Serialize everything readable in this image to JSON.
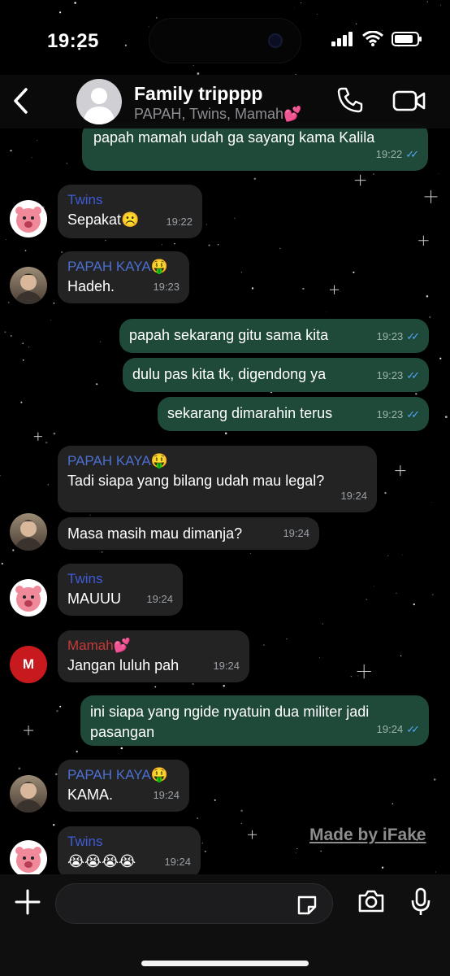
{
  "status": {
    "time": "19:25"
  },
  "header": {
    "title": "Family tripppp",
    "subtitle": "PAPAH, Twins, Mamah💕"
  },
  "messages": [
    {
      "dir": "out",
      "text": "papah mamah udah ga sayang kama Kalila",
      "time": "19:22"
    },
    {
      "dir": "in",
      "sender": "Twins",
      "text": "Sepakat☹️",
      "time": "19:22"
    },
    {
      "dir": "in",
      "sender": "PAPAH KAYA🤑",
      "text": "Hadeh.",
      "time": "19:23"
    },
    {
      "dir": "out",
      "text": "papah sekarang gitu sama kita",
      "time": "19:23"
    },
    {
      "dir": "out",
      "text": "dulu pas kita tk, digendong ya",
      "time": "19:23"
    },
    {
      "dir": "out",
      "text": "sekarang dimarahin terus",
      "time": "19:23"
    },
    {
      "dir": "in",
      "sender": "PAPAH KAYA🤑",
      "text": "Tadi siapa yang bilang udah mau legal?",
      "time": "19:24"
    },
    {
      "dir": "in",
      "text": "Masa masih mau dimanja?",
      "time": "19:24"
    },
    {
      "dir": "in",
      "sender": "Twins",
      "text": "MAUUU",
      "time": "19:24"
    },
    {
      "dir": "in",
      "sender": "Mamah💕",
      "avatar_letter": "M",
      "text": "Jangan luluh pah",
      "time": "19:24"
    },
    {
      "dir": "out",
      "text_line1": "ini siapa yang ngide nyatuin dua militer jadi",
      "text_line2": "pasangan",
      "time": "19:24"
    },
    {
      "dir": "in",
      "sender": "PAPAH KAYA🤑",
      "text": "KAMA.",
      "time": "19:24"
    },
    {
      "dir": "in",
      "sender": "Twins",
      "text": "😭😭😭😭",
      "time": "19:24"
    }
  ],
  "watermark": "Made by iFake",
  "icons": {
    "back": "chevron-left-icon",
    "call": "phone-icon",
    "video": "video-camera-icon",
    "plus": "plus-icon",
    "sticker": "sticker-icon",
    "camera": "camera-icon",
    "mic": "microphone-icon"
  },
  "colors": {
    "outgoing_bubble": "#1f4a39",
    "incoming_bubble": "#232323",
    "read_ticks": "#53a6f5",
    "twins_name": "#3f5bd6",
    "papah_name": "#4b6fcf",
    "mamah_name": "#c73a3a"
  }
}
